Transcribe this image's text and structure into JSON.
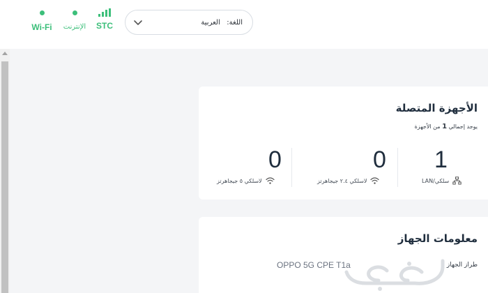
{
  "status_bar": {
    "wifi_label": "Wi-Fi",
    "internet_label": "الإنترنت",
    "carrier_label": "STC",
    "accent_color": "#3cbf7a"
  },
  "language": {
    "label": "اللغة:",
    "value": "العربية",
    "icon": "chevron-down-icon"
  },
  "connected_devices": {
    "title": "الأجهزة المتصلة",
    "subtitle_before": "يوجد إجمالي",
    "total": "1",
    "subtitle_after": "من الأجهزة",
    "stats": [
      {
        "value": "1",
        "label": "سلكي/LAN",
        "icon": "lan-icon"
      },
      {
        "value": "0",
        "label": "لاسلكي ٢.٤ جيجاهرتز",
        "icon": "wifi-icon"
      },
      {
        "value": "0",
        "label": "لاسلكي ٥ جيجاهرتز",
        "icon": "wifi-icon"
      }
    ]
  },
  "device_info": {
    "title": "معلومات الجهاز",
    "model_label": "طراز الجهاز",
    "model_value": "OPPO 5G CPE T1a"
  }
}
